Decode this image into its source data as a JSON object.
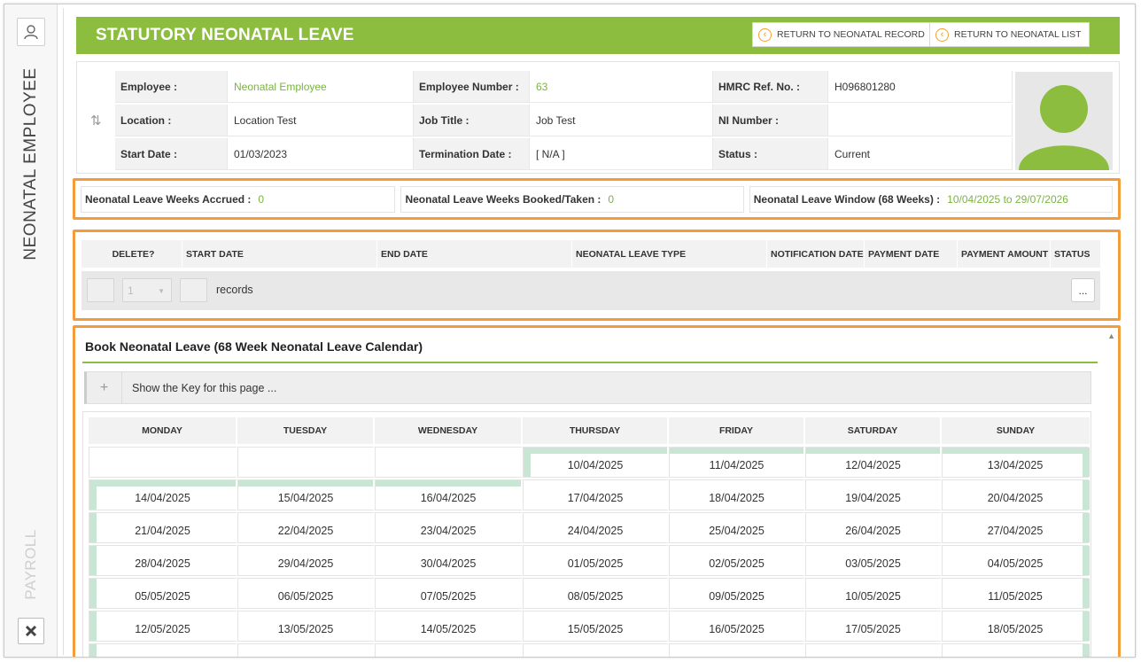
{
  "sidebar": {
    "title": "NEONATAL EMPLOYEE",
    "payroll": "PAYROLL"
  },
  "header": {
    "title": "STATUTORY NEONATAL LEAVE",
    "return_record": "RETURN TO NEONATAL RECORD",
    "return_list": "RETURN TO NEONATAL LIST",
    "color": "#8cbd3f"
  },
  "employee": {
    "employee_label": "Employee :",
    "employee_value": "Neonatal Employee",
    "number_label": "Employee Number :",
    "number_value": "63",
    "hmrc_label": "HMRC Ref. No. :",
    "hmrc_value": "H096801280",
    "location_label": "Location :",
    "location_value": "Location Test",
    "job_label": "Job Title :",
    "job_value": "Job Test",
    "ni_label": "NI Number :",
    "ni_value": "",
    "start_label": "Start Date :",
    "start_value": "01/03/2023",
    "term_label": "Termination Date :",
    "term_value": "[ N/A ]",
    "status_label": "Status :",
    "status_value": "Current"
  },
  "summary": {
    "accrued_label": "Neonatal Leave Weeks Accrued :",
    "accrued_value": "0",
    "booked_label": "Neonatal Leave Weeks Booked/Taken :",
    "booked_value": "0",
    "window_label": "Neonatal Leave Window (68 Weeks) :",
    "window_value": "10/04/2025 to 29/07/2026"
  },
  "leave_table": {
    "columns": [
      "DELETE?",
      "START DATE",
      "END DATE",
      "NEONATAL LEAVE TYPE",
      "NOTIFICATION DATE",
      "PAYMENT DATE",
      "PAYMENT AMOUNT",
      "STATUS"
    ],
    "page_value": "1",
    "records_label": "records",
    "more_label": "..."
  },
  "calendar": {
    "title": "Book Neonatal Leave (68 Week Neonatal Leave Calendar)",
    "key_label": "Show the Key for this page ...",
    "days": [
      "MONDAY",
      "TUESDAY",
      "WEDNESDAY",
      "THURSDAY",
      "FRIDAY",
      "SATURDAY",
      "SUNDAY"
    ],
    "weeks": [
      [
        "",
        "",
        "",
        "10/04/2025",
        "11/04/2025",
        "12/04/2025",
        "13/04/2025"
      ],
      [
        "14/04/2025",
        "15/04/2025",
        "16/04/2025",
        "17/04/2025",
        "18/04/2025",
        "19/04/2025",
        "20/04/2025"
      ],
      [
        "21/04/2025",
        "22/04/2025",
        "23/04/2025",
        "24/04/2025",
        "25/04/2025",
        "26/04/2025",
        "27/04/2025"
      ],
      [
        "28/04/2025",
        "29/04/2025",
        "30/04/2025",
        "01/05/2025",
        "02/05/2025",
        "03/05/2025",
        "04/05/2025"
      ],
      [
        "05/05/2025",
        "06/05/2025",
        "07/05/2025",
        "08/05/2025",
        "09/05/2025",
        "10/05/2025",
        "11/05/2025"
      ],
      [
        "12/05/2025",
        "13/05/2025",
        "14/05/2025",
        "15/05/2025",
        "16/05/2025",
        "17/05/2025",
        "18/05/2025"
      ]
    ],
    "window_color": "#c8e6d3"
  },
  "highlight_color": "#f39c3c"
}
